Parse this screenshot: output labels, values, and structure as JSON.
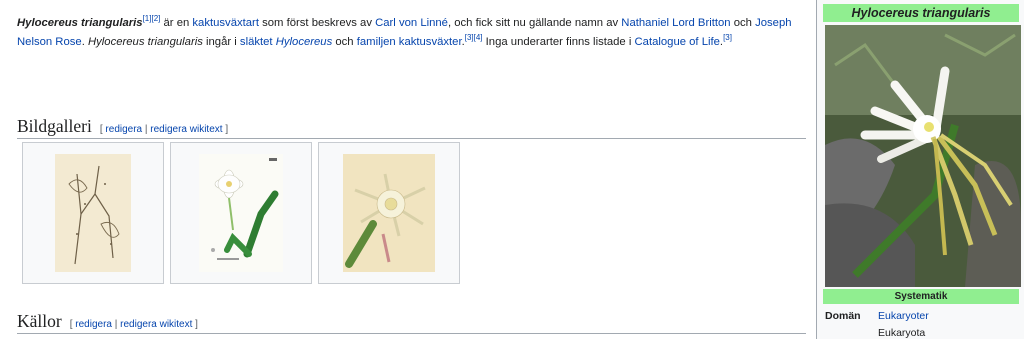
{
  "intro": {
    "taxon": "Hylocereus triangularis",
    "ref12": "[1][2]",
    "t1": " är en ",
    "link_cactus_species": "kaktusväxtart",
    "t2": " som först beskrevs av ",
    "link_linne": "Carl von Linné",
    "t3": ", och fick sitt nu gällande namn av ",
    "link_britton": "Nathaniel Lord Britton",
    "t4": " och ",
    "link_rose": "Joseph Nelson Rose",
    "t5": ". ",
    "taxon2": "Hylocereus triangularis",
    "t6": " ingår i ",
    "link_genus_prefix": "släktet ",
    "link_genus_name": "Hylocereus",
    "t7": " och ",
    "link_family": "familjen kaktusväxter",
    "t8": ".",
    "ref34": "[3][4]",
    "t9": " Inga underarter finns listade i ",
    "link_col": "Catalogue of Life",
    "t10": ".",
    "ref3": "[3]"
  },
  "gallery_section": {
    "title": "Bildgalleri",
    "edit_open": "[ ",
    "edit": "redigera",
    "sep": " | ",
    "edit_wikitext": "redigera wikitext",
    "edit_close": " ]"
  },
  "refs_section": {
    "title": "Källor",
    "edit_open": "[ ",
    "edit": "redigera",
    "sep": " | ",
    "edit_wikitext": "redigera wikitext",
    "edit_close": " ]"
  },
  "infobox": {
    "title": "Hylocereus triangularis",
    "systematics": "Systematik",
    "rows": [
      {
        "label": "Domän",
        "value_link": "Eukaryoter",
        "value_extra": "Eukaryota"
      }
    ]
  },
  "colors": {
    "link": "#0645ad",
    "infobox_header": "#90ee90",
    "border": "#a2a9b1"
  }
}
